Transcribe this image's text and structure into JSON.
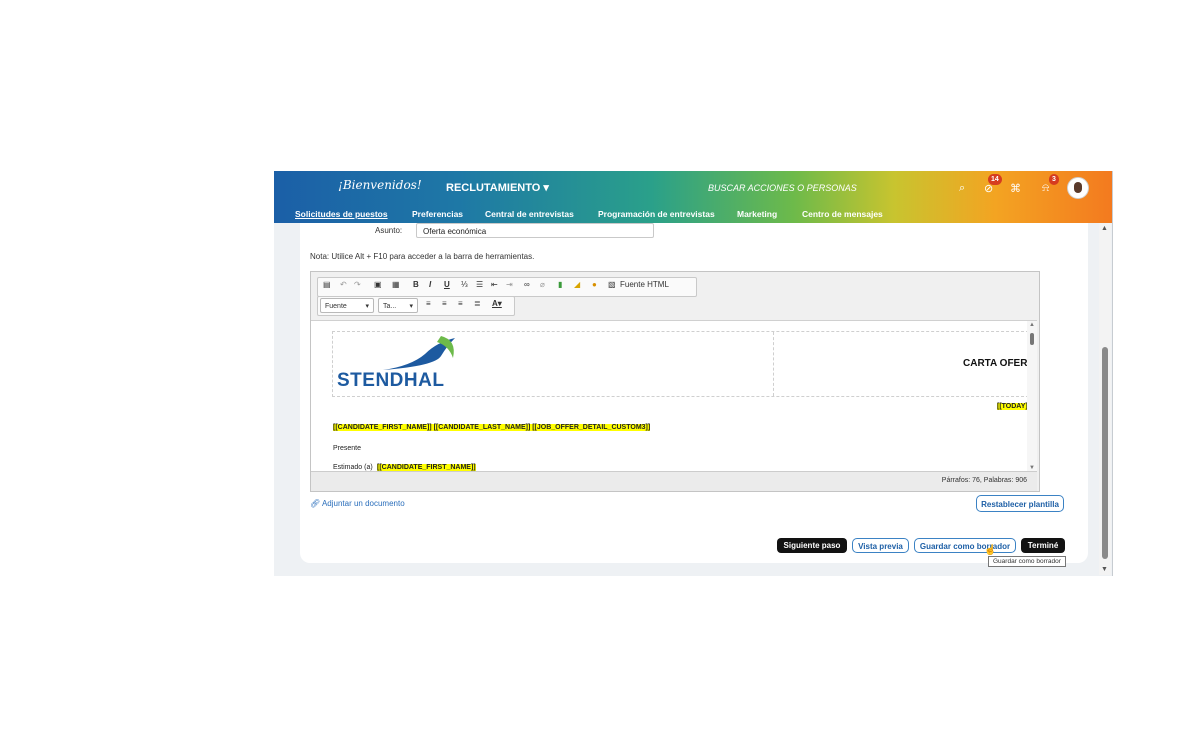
{
  "header": {
    "logo_text": "¡Bienvenidos!",
    "module_label": "RECLUTAMIENTO ▾",
    "search_placeholder": "BUSCAR ACCIONES O PERSONAS",
    "notifications_badge": "14",
    "alerts_badge": "3"
  },
  "nav": {
    "items": [
      {
        "label": "Solicitudes de puestos"
      },
      {
        "label": "Preferencias"
      },
      {
        "label": "Central de entrevistas"
      },
      {
        "label": "Programación de entrevistas"
      },
      {
        "label": "Marketing"
      },
      {
        "label": "Centro de mensajes"
      }
    ]
  },
  "form": {
    "subject_label": "Asunto:",
    "subject_value": "Oferta económica",
    "note": "Nota: Utilice Alt + F10 para acceder a la barra de herramientas."
  },
  "editor": {
    "toolbar": {
      "html_source_label": "Fuente HTML",
      "font_select": "Fuente",
      "size_select": "Ta..."
    },
    "document": {
      "company_name": "STENDHAL",
      "title": "CARTA OFERTA",
      "today_token": "[[TODAY]]",
      "candidate_line": "[[CANDIDATE_FIRST_NAME]] [[CANDIDATE_LAST_NAME]] [[JOB_OFFER_DETAIL_CUSTOM3]]",
      "presente": "Presente",
      "estimado_prefix": "Estimado (a)",
      "estimado_token": "[[CANDIDATE_FIRST_NAME]]"
    },
    "status": "Párrafos: 76, Palabras: 906"
  },
  "actions": {
    "attach_label": "Adjuntar un documento",
    "reset_template": "Restablecer plantilla",
    "next_step": "Siguiente paso",
    "preview": "Vista previa",
    "save_draft": "Guardar como borrador",
    "done": "Terminé",
    "tooltip": "Guardar como borrador"
  },
  "colors": {
    "primary_blue": "#1d5fa6",
    "dark_button": "#121212",
    "highlight": "#ffff00",
    "badge_red": "#d63c1f"
  }
}
